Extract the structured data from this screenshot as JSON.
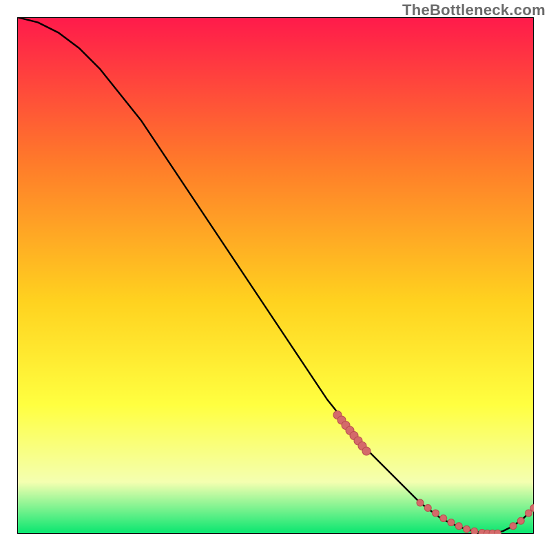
{
  "watermark": "TheBottleneck.com",
  "colors": {
    "gradient_top": "#ff1a4b",
    "gradient_mid1": "#ff7a2a",
    "gradient_mid2": "#ffd21f",
    "gradient_mid3": "#ffff40",
    "gradient_mid4": "#f4ffb0",
    "gradient_bottom": "#07e66f",
    "frame": "#000000",
    "curve": "#000000",
    "dot": "#d46a6a",
    "dot_stroke": "#b74e4e"
  },
  "chart_data": {
    "type": "line",
    "title": "",
    "xlabel": "",
    "ylabel": "",
    "xlim": [
      0,
      100
    ],
    "ylim": [
      0,
      100
    ],
    "legend": false,
    "grid": false,
    "series": [
      {
        "name": "bottleneck-curve",
        "x": [
          0,
          4,
          8,
          12,
          16,
          20,
          24,
          28,
          32,
          36,
          40,
          44,
          48,
          52,
          56,
          60,
          64,
          68,
          72,
          76,
          78,
          80,
          82,
          84,
          86,
          88,
          90,
          92,
          94,
          96,
          98,
          100
        ],
        "values": [
          100,
          99,
          97,
          94,
          90,
          85,
          80,
          74,
          68,
          62,
          56,
          50,
          44,
          38,
          32,
          26,
          21,
          16,
          12,
          8,
          6,
          4.5,
          3,
          2,
          1.2,
          0.6,
          0.2,
          0.1,
          0.5,
          1.5,
          3,
          5
        ]
      }
    ],
    "dots_upper": {
      "name": "cluster-steep",
      "x": [
        62,
        62.8,
        63.6,
        64.4,
        65.2,
        66,
        66.8,
        67.6
      ],
      "values": [
        23,
        22,
        21,
        20,
        19,
        18,
        17,
        16
      ]
    },
    "dots_lower": {
      "name": "cluster-trough",
      "x": [
        78,
        79.5,
        81,
        82.5,
        84,
        85.5,
        87,
        88.5,
        90,
        91,
        92,
        93,
        96,
        97.5,
        99,
        100
      ],
      "values": [
        6,
        5,
        4,
        3,
        2.2,
        1.5,
        0.9,
        0.5,
        0.2,
        0.1,
        0.1,
        0.1,
        1.5,
        2.5,
        4,
        5
      ]
    }
  }
}
